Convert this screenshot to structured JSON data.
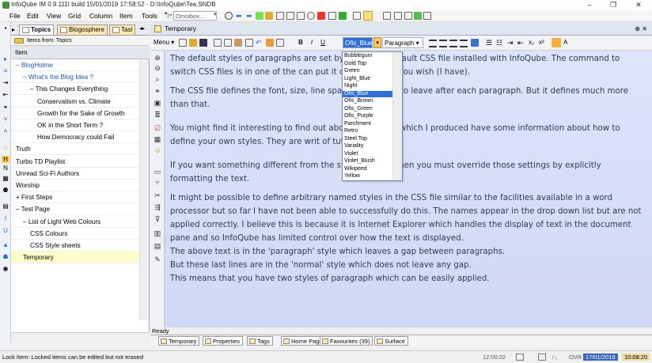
{
  "window": {
    "title": "InfoQube IM 0.9.111I  build 15/01/2019 17:58:52 - D:\\InfoQube\\Tea.SNDB",
    "minimize": "–",
    "maximize": "❐",
    "close": "✕"
  },
  "menubar": {
    "items": [
      "File",
      "Edit",
      "View",
      "Grid",
      "Column",
      "Item",
      "Tools"
    ],
    "omnibox_placeholder": "Omnibox..."
  },
  "left_pane": {
    "tabs": [
      "Topics",
      "Blogosphere",
      "Tasl"
    ],
    "source": "Items from: Topics",
    "column_header": "Item",
    "rows": [
      {
        "text": "– BlogHolme",
        "indent": 0,
        "blue": true
      },
      {
        "text": "– What's the Blog Idea ?",
        "indent": 1,
        "blue": true
      },
      {
        "text": "– This Changes Everything",
        "indent": 2,
        "blue": false
      },
      {
        "text": "Conservatism vs. Climate",
        "indent": 3,
        "blue": false
      },
      {
        "text": "Growth for the Sake of Growth",
        "indent": 3,
        "blue": false
      },
      {
        "text": "OK in the Short Term ?",
        "indent": 3,
        "blue": false
      },
      {
        "text": "How Democracy could Fail",
        "indent": 3,
        "blue": false
      },
      {
        "text": "Truth",
        "indent": 0,
        "blue": false
      },
      {
        "text": "Turbo TD Playlist",
        "indent": 0,
        "blue": false
      },
      {
        "text": "Unread Sci-Fi Authors",
        "indent": 0,
        "blue": false
      },
      {
        "text": "Worship",
        "indent": 0,
        "blue": false
      },
      {
        "text": "+ First Steps",
        "indent": 0,
        "blue": false
      },
      {
        "text": "– Test Page",
        "indent": 0,
        "blue": false
      },
      {
        "text": "– List of Light Web Colours",
        "indent": 1,
        "blue": false
      },
      {
        "text": "CSS Colours",
        "indent": 2,
        "blue": false
      },
      {
        "text": "CSS Style sheets",
        "indent": 2,
        "blue": false
      },
      {
        "text": "Temporary",
        "indent": 1,
        "blue": false,
        "selected": true
      }
    ]
  },
  "right_pane": {
    "title": "Temporary",
    "close_label": "✕",
    "pin_label": "⊕",
    "toolbar": {
      "menu_label": "Menu",
      "bold": "B",
      "italic": "I",
      "underline": "U",
      "style_value": "Ofis_Blue",
      "paragraph_value": "Paragraph"
    },
    "style_options": [
      "Bubblegum",
      "Gold Top",
      "Green",
      "Light_Blue",
      "Night",
      "Ofis_Blue",
      "Ofis_Brown",
      "Ofis_Green",
      "Ofis_Purple",
      "Parchment",
      "Retro",
      "Steel Top",
      "Variality",
      "Violet",
      "Violet_Blush",
      "Wikipeed",
      "Yellow"
    ],
    "selected_style": "Ofis_Blue",
    "paragraphs": [
      "The default styles of paragraphs are set by                          There is a default CSS file installed with InfoQube. The command to switch CSS files is in one of the                          can put it on a toolbar if you wish (I have).",
      "The CSS file defines the font, size, line spac                          much space to leave after each paragraph.  But it defines much more than that.",
      "You might find it interesting to find out abo                          the CSS files which I produced have some information about how to define your own styles. They are writ                          of tutorial.",
      "If you want something different from the st                          the CSS file then you must override those settings by explicitly formatting the text.",
      "It might be possible to define arbitrary named styles in the CSS file similar to the facilities available in a word processor but so far I have not been able to successfully do this. The names appear in the drop down list but are not applied correctly.  I believe this is because it is Internet Explorer which handles the display of text in the document pane and so InfoQube has limited control over how the text is displayed.",
      "The above text is in the 'paragraph' style which leaves a gap between paragraphs.",
      "But these last lines are in the 'normal' style which does not leave any gap.",
      "This means that you have two styles of paragraph which can be easily applied."
    ],
    "status": "Ready",
    "bottom_tabs": [
      "Temporary",
      "Properties",
      "Tags",
      "Home Page",
      "Favourites (39)",
      "Surface"
    ]
  },
  "statusbar": {
    "message": "Lock Item: Locked items can be edited but not erased",
    "time_left": "12:00:02",
    "ovr": "OVR",
    "date": "17/01/2019",
    "time": "10:08:20"
  },
  "colors": {
    "doc_text": "#293b57",
    "doc_bg": "#d6ddf8",
    "link_blue": "#1e56c0",
    "selection": "#2f6fd5"
  }
}
